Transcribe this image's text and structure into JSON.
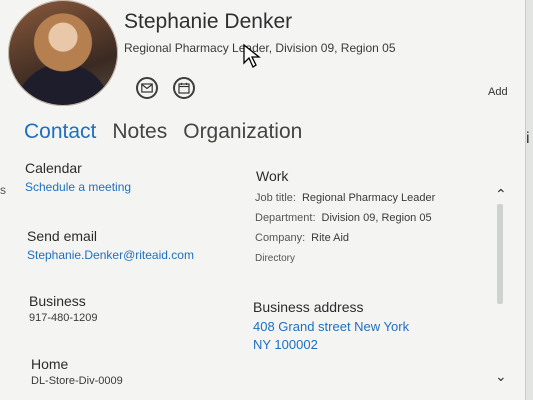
{
  "header": {
    "name": "Stephanie Denker",
    "role": "Regional Pharmacy Leader, Division 09, Region 05",
    "add_label": "Add",
    "actions": [
      {
        "icon": "mail-icon"
      },
      {
        "icon": "calendar-icon"
      }
    ]
  },
  "tabs": [
    "Contact",
    "Notes",
    "Organization"
  ],
  "contact": {
    "calendar_label": "Calendar",
    "calendar_link": "Schedule a meeting",
    "send_email_label": "Send email",
    "email": "Stephanie.Denker@riteaid.com",
    "business_label": "Business",
    "business_phone": "917-480-1209",
    "home_label": "Home",
    "home_value": "DL-Store-Div-0009"
  },
  "work": {
    "title": "Work",
    "job_title_label": "Job title:",
    "job_title": "Regional Pharmacy Leader",
    "department_label": "Department:",
    "department": "Division 09, Region 05",
    "company_label": "Company:",
    "company": "Rite Aid",
    "directory_label": "Directory",
    "business_address_label": "Business address",
    "address_line1": "408 Grand street New York",
    "address_line2": "NY 100002"
  },
  "edge_fragments": {
    "right": "i",
    "left": "s"
  },
  "colors": {
    "accent": "#1f6fbf"
  }
}
